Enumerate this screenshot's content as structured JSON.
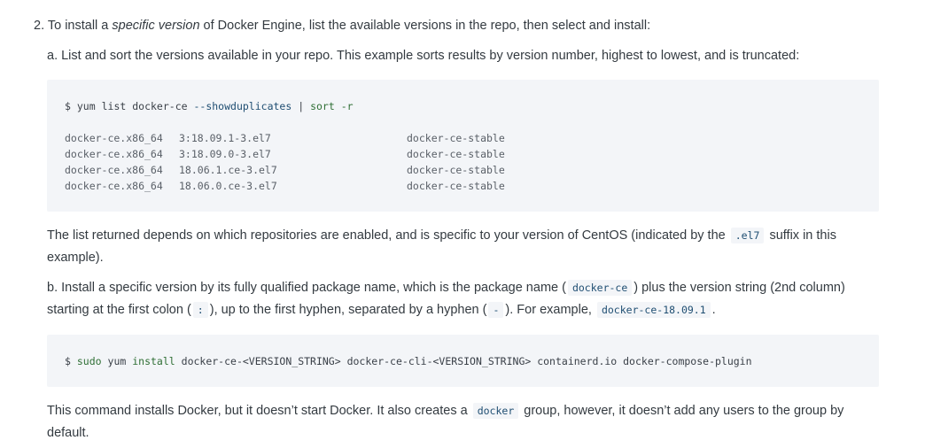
{
  "step2": {
    "prefix": "2. To install a ",
    "emphasis": "specific version",
    "suffix": " of Docker Engine, list the available versions in the repo, then select and install:"
  },
  "step_a": "a. List and sort the versions available in your repo. This example sorts results by version number, highest to lowest, and is truncated:",
  "code1": {
    "prompt": "$",
    "cmd": "yum",
    "sub": "list",
    "pkg": "docker-ce",
    "flag": "--showduplicates",
    "pipe": "|",
    "sort": "sort",
    "sort_flag": "-r",
    "rows": [
      {
        "pkg": "docker-ce.x86_64",
        "ver": "3:18.09.1-3.el7",
        "repo": "docker-ce-stable"
      },
      {
        "pkg": "docker-ce.x86_64",
        "ver": "3:18.09.0-3.el7",
        "repo": "docker-ce-stable"
      },
      {
        "pkg": "docker-ce.x86_64",
        "ver": "18.06.1.ce-3.el7",
        "repo": "docker-ce-stable"
      },
      {
        "pkg": "docker-ce.x86_64",
        "ver": "18.06.0.ce-3.el7",
        "repo": "docker-ce-stable"
      }
    ]
  },
  "para1": {
    "line1_prefix": "The list returned depends on which repositories are enabled, and is specific to your version of CentOS (indicated by the ",
    "code": ".el7",
    "line1_suffix": " suffix in this",
    "line2": "example)."
  },
  "step_b": {
    "l1_a": "b. Install a specific version by its fully qualified package name, which is the package name (",
    "l1_code": "docker-ce",
    "l1_b": ") plus the version string (2nd column)",
    "l2_a": "starting at the first colon (",
    "l2_code1": ":",
    "l2_b": "), up to the first hyphen, separated by a hyphen (",
    "l2_code2": "-",
    "l2_c": "). For example, ",
    "l2_code3": "docker-ce-18.09.1",
    "l2_d": "."
  },
  "code2": {
    "prompt": "$",
    "sudo": "sudo",
    "yum": "yum",
    "install": "install",
    "args": "docker-ce-<VERSION_STRING> docker-ce-cli-<VERSION_STRING> containerd.io docker-compose-plugin"
  },
  "para2": {
    "l1_a": "This command installs Docker, but it doesn’t start Docker. It also creates a ",
    "l1_code": "docker",
    "l1_b": " group, however, it doesn’t add any users to the group by",
    "l2": "default."
  }
}
